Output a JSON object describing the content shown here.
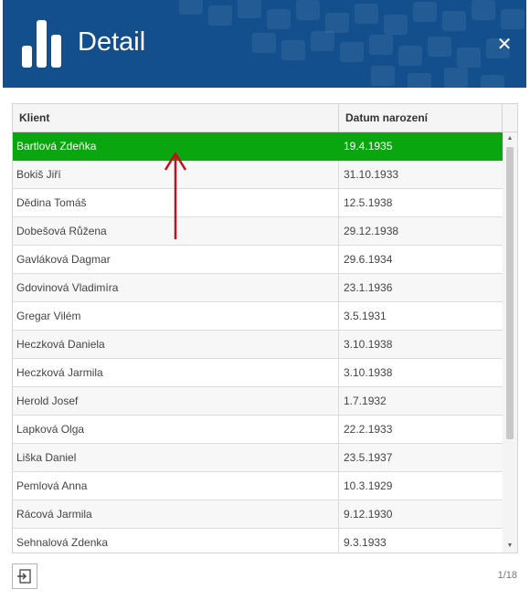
{
  "header": {
    "title": "Detail",
    "close_glyph": "✕",
    "colors": {
      "background": "#134f8c",
      "text": "#ffffff"
    }
  },
  "grid": {
    "columns": [
      "Klient",
      "Datum narození"
    ],
    "rows": [
      {
        "client": "Bartlová Zdeňka",
        "date": "19.4.1935",
        "selected": true
      },
      {
        "client": "Bokiš Jiří",
        "date": "31.10.1933"
      },
      {
        "client": "Dědina Tomáš",
        "date": "12.5.1938"
      },
      {
        "client": "Dobešová Růžena",
        "date": "29.12.1938"
      },
      {
        "client": "Gavláková Dagmar",
        "date": "29.6.1934"
      },
      {
        "client": "Gdovinová Vladimíra",
        "date": "23.1.1936"
      },
      {
        "client": "Gregar Vilém",
        "date": "3.5.1931"
      },
      {
        "client": "Heczková Daniela",
        "date": "3.10.1938"
      },
      {
        "client": "Heczková Jarmila",
        "date": "3.10.1938"
      },
      {
        "client": "Herold Josef",
        "date": "1.7.1932"
      },
      {
        "client": "Lapková Olga",
        "date": "22.2.1933"
      },
      {
        "client": "Liška Daniel",
        "date": "23.5.1937"
      },
      {
        "client": "Pemlová Anna",
        "date": "10.3.1929"
      },
      {
        "client": "Rácová Jarmila",
        "date": "9.12.1930"
      },
      {
        "client": "Sehnalová Zdenka",
        "date": "9.3.1933"
      }
    ],
    "selected_color": "#0aa60f"
  },
  "annotation": {
    "arrow_color": "#c0121b",
    "direction": "up"
  },
  "footer": {
    "export_icon": "export-icon",
    "pager": "1/18"
  }
}
